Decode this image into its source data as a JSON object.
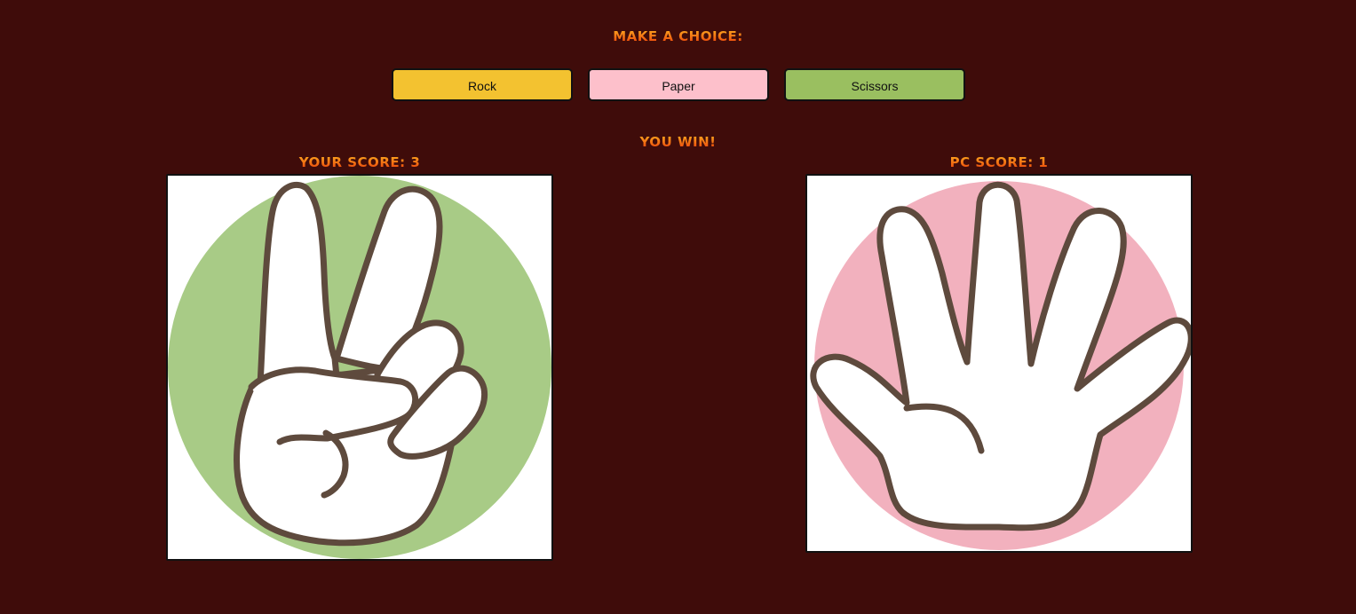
{
  "prompt": {
    "title": "Make a choice:"
  },
  "buttons": {
    "rock": "Rock",
    "paper": "Paper",
    "scissors": "Scissors"
  },
  "result": {
    "text": "You win!"
  },
  "player": {
    "score_label": "Your score: 3",
    "choice_icon": "scissors-hand-icon",
    "circle_color": "#a8cb86"
  },
  "pc": {
    "score_label": "PC score: 1",
    "choice_icon": "paper-hand-icon",
    "circle_color": "#f2b1be"
  },
  "colors": {
    "background": "#3f0c0a",
    "rock": "#f3c230",
    "paper": "#fdc0cb",
    "scissors": "#9abf60",
    "hand_outline": "#5e4a3d"
  }
}
